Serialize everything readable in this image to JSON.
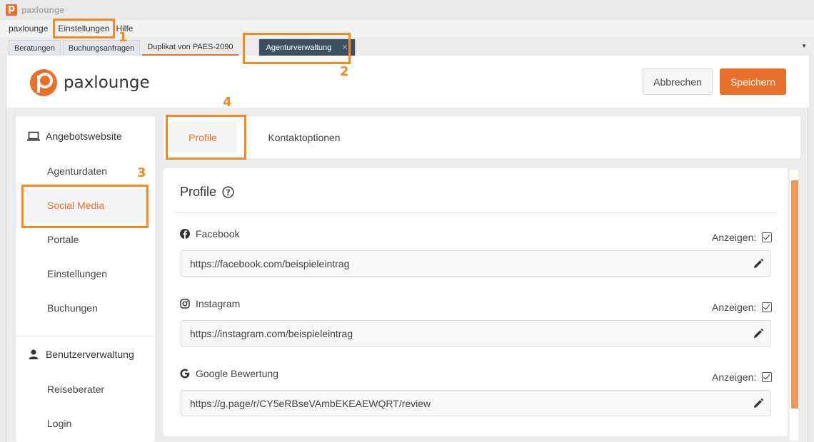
{
  "window": {
    "title": "paxlounge"
  },
  "menu": {
    "items": [
      "paxlounge",
      "Einstellungen",
      "Hilfe"
    ]
  },
  "tabs": {
    "items": [
      "Beratungen",
      "Buchungsanfragen",
      "Duplikat von PAES-2090"
    ],
    "active": "Agenturverwaltung",
    "close_glyph": "✕"
  },
  "header": {
    "logo_text": "paxlounge",
    "cancel_label": "Abbrechen",
    "save_label": "Speichern"
  },
  "sidebar": {
    "group1": "Angebotswebsite",
    "items1": [
      "Agenturdaten",
      "Social Media",
      "Portale",
      "Einstellungen",
      "Buchungen"
    ],
    "active_item": "Social Media",
    "group2": "Benutzerverwaltung",
    "items2": [
      "Reiseberater",
      "Login"
    ]
  },
  "content_tabs": {
    "profile": "Profile",
    "contact": "Kontaktoptionen"
  },
  "card": {
    "title": "Profile",
    "show_label": "Anzeigen:",
    "fields": [
      {
        "label": "Facebook",
        "icon": "facebook-icon",
        "value": "https://facebook.com/beispieleintrag",
        "show": true
      },
      {
        "label": "Instagram",
        "icon": "instagram-icon",
        "value": "https://instagram.com/beispieleintrag",
        "show": true
      },
      {
        "label": "Google Bewertung",
        "icon": "google-icon",
        "value": "https://g.page/r/CY5eRBseVAmbEKEAEWQRT/review",
        "show": true
      }
    ]
  },
  "annotations": [
    "1",
    "2",
    "3",
    "4"
  ],
  "colors": {
    "accent": "#e8702a",
    "annotation": "#f58b1f",
    "active_tab": "#3d5062"
  }
}
